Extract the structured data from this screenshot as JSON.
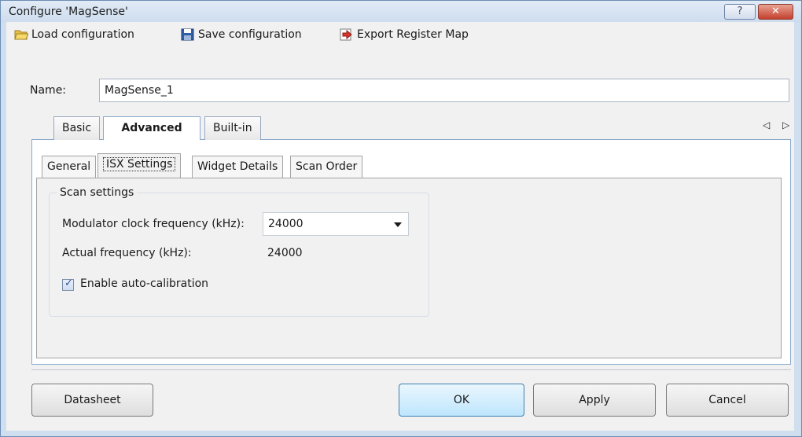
{
  "window": {
    "title": "Configure 'MagSense'",
    "help_label": "?",
    "close_label": "✕"
  },
  "toolbar": {
    "load_label": "Load configuration",
    "save_label": "Save configuration",
    "export_label": "Export Register Map"
  },
  "name_row": {
    "label": "Name:",
    "value": "MagSense_1"
  },
  "main_tabs": [
    {
      "label": "Basic"
    },
    {
      "label": "Advanced",
      "active": true
    },
    {
      "label": "Built-in"
    }
  ],
  "tab_nav": "◁ ▷",
  "sub_tabs": [
    {
      "label": "General"
    },
    {
      "label": "ISX Settings",
      "active": true
    },
    {
      "label": "Widget Details"
    },
    {
      "label": "Scan Order"
    }
  ],
  "scan_settings": {
    "group_title": "Scan settings",
    "modulator_label": "Modulator clock frequency (kHz):",
    "modulator_value": "24000",
    "actual_label": "Actual frequency (kHz):",
    "actual_value": "24000",
    "autocal_label": "Enable auto-calibration",
    "autocal_checked": true
  },
  "buttons": {
    "datasheet": "Datasheet",
    "ok": "OK",
    "apply": "Apply",
    "cancel": "Cancel"
  },
  "colors": {
    "title_bg": "#cddcee",
    "close_bg": "#c4402e",
    "tab_border": "#8aa9cc",
    "default_button": "#bee6fd"
  }
}
